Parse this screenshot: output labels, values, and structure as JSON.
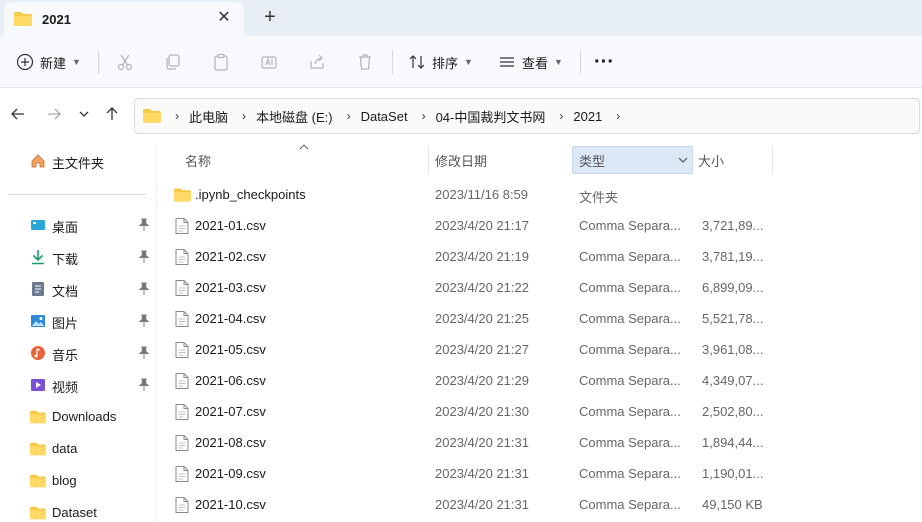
{
  "window": {
    "tab_title": "2021",
    "close_glyph": "✕",
    "new_tab_glyph": "+"
  },
  "toolbar": {
    "new_label": "新建",
    "sort_label": "排序",
    "view_label": "查看",
    "more_glyph": "···"
  },
  "breadcrumb": [
    "此电脑",
    "本地磁盘 (E:)",
    "DataSet",
    "04-中国裁判文书网",
    "2021"
  ],
  "sidebar": {
    "home": "主文件夹",
    "pinned": [
      "桌面",
      "下载",
      "文档",
      "图片",
      "音乐",
      "视频"
    ],
    "folders": [
      "Downloads",
      "data",
      "blog",
      "Dataset"
    ]
  },
  "columns": {
    "name": "名称",
    "date": "修改日期",
    "type": "类型",
    "size": "大小"
  },
  "files": [
    {
      "name": ".ipynb_checkpoints",
      "date": "2023/11/16 8:59",
      "type": "文件夹",
      "size": "",
      "kind": "folder"
    },
    {
      "name": "2021-01.csv",
      "date": "2023/4/20 21:17",
      "type": "Comma Separa...",
      "size": "3,721,89...",
      "kind": "file"
    },
    {
      "name": "2021-02.csv",
      "date": "2023/4/20 21:19",
      "type": "Comma Separa...",
      "size": "3,781,19...",
      "kind": "file"
    },
    {
      "name": "2021-03.csv",
      "date": "2023/4/20 21:22",
      "type": "Comma Separa...",
      "size": "6,899,09...",
      "kind": "file"
    },
    {
      "name": "2021-04.csv",
      "date": "2023/4/20 21:25",
      "type": "Comma Separa...",
      "size": "5,521,78...",
      "kind": "file"
    },
    {
      "name": "2021-05.csv",
      "date": "2023/4/20 21:27",
      "type": "Comma Separa...",
      "size": "3,961,08...",
      "kind": "file"
    },
    {
      "name": "2021-06.csv",
      "date": "2023/4/20 21:29",
      "type": "Comma Separa...",
      "size": "4,349,07...",
      "kind": "file"
    },
    {
      "name": "2021-07.csv",
      "date": "2023/4/20 21:30",
      "type": "Comma Separa...",
      "size": "2,502,80...",
      "kind": "file"
    },
    {
      "name": "2021-08.csv",
      "date": "2023/4/20 21:31",
      "type": "Comma Separa...",
      "size": "1,894,44...",
      "kind": "file"
    },
    {
      "name": "2021-09.csv",
      "date": "2023/4/20 21:31",
      "type": "Comma Separa...",
      "size": "1,190,01...",
      "kind": "file"
    },
    {
      "name": "2021-10.csv",
      "date": "2023/4/20 21:31",
      "type": "Comma Separa...",
      "size": "49,150 KB",
      "kind": "file"
    }
  ],
  "colors": {
    "accent": "#0067c0",
    "folder": "#f7c948",
    "tabstrip": "#e8eef6",
    "selected_header": "#dde8f6"
  }
}
